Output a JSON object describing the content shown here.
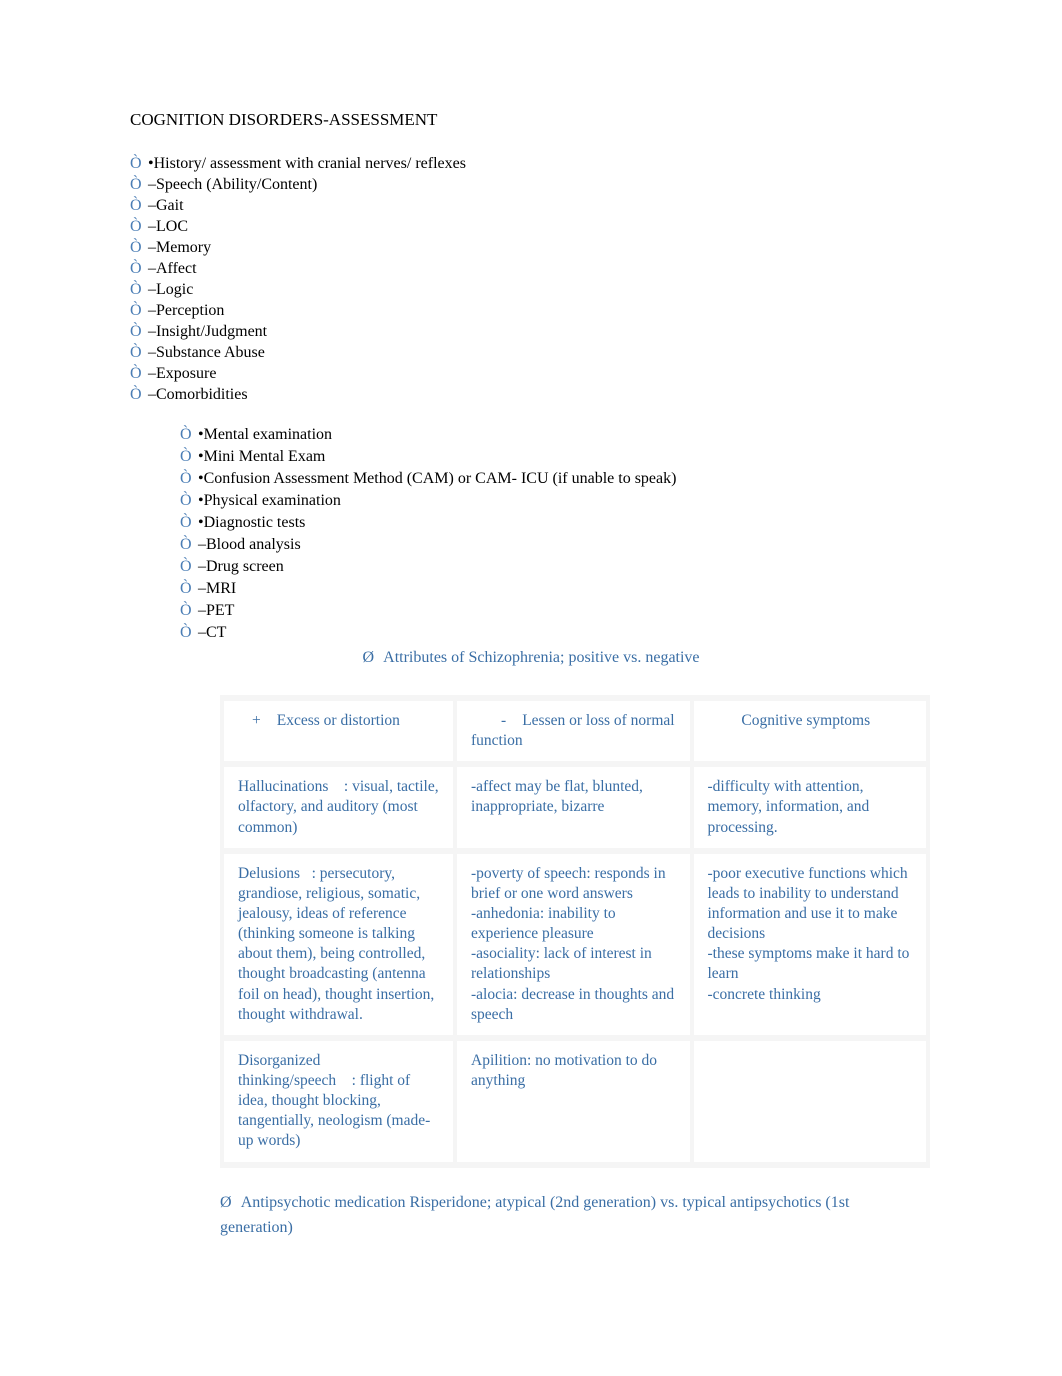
{
  "title": "COGNITION DISORDERS-ASSESSMENT",
  "bullets_a": [
    "•History/ assessment with cranial nerves/ reflexes",
    "–Speech (Ability/Content)",
    "–Gait",
    "–LOC",
    "–Memory",
    "–Affect",
    "–Logic",
    "–Perception",
    "–Insight/Judgment",
    "–Substance Abuse",
    "–Exposure",
    "–Comorbidities"
  ],
  "bullets_b": [
    "•Mental examination",
    "•Mini Mental Exam",
    "•Confusion Assessment Method (CAM) or CAM- ICU (if unable to speak)",
    "•Physical examination",
    "•Diagnostic tests",
    "–Blood analysis",
    "–Drug screen",
    "–MRI",
    "–PET",
    "–CT"
  ],
  "heading_attr": "Attributes of Schizophrenia; positive vs. negative",
  "table": {
    "headers": {
      "col1": "Excess or distortion",
      "col2": "Lessen or loss of normal function",
      "col3": "Cognitive symptoms"
    },
    "rows": [
      {
        "c1": "Hallucinations    : visual, tactile, olfactory, and auditory (most common)",
        "c2": "-affect may be flat, blunted, inappropriate, bizarre",
        "c3": "-difficulty with attention, memory, information, and processing."
      },
      {
        "c1": "Delusions   : persecutory, grandiose, religious, somatic, jealousy, ideas of reference (thinking someone is talking about them), being controlled, thought broadcasting (antenna foil on head), thought insertion, thought withdrawal.",
        "c2": "-poverty of speech: responds in brief or one word answers\n-anhedonia: inability to experience pleasure\n-asociality: lack of interest in relationships\n-alocia: decrease in thoughts and speech",
        "c3": "-poor executive functions which leads to inability to understand information and use it to make decisions\n-these symptoms make it hard to learn\n-concrete thinking"
      },
      {
        "c1": "Disorganized thinking/speech    : flight of idea, thought blocking, tangentially, neologism (made-up words)",
        "c2": "Apilition: no motivation to do anything",
        "c3": ""
      }
    ]
  },
  "heading_med": "Antipsychotic medication Risperidone; atypical (2nd generation) vs. typical antipsychotics (1st generation)"
}
